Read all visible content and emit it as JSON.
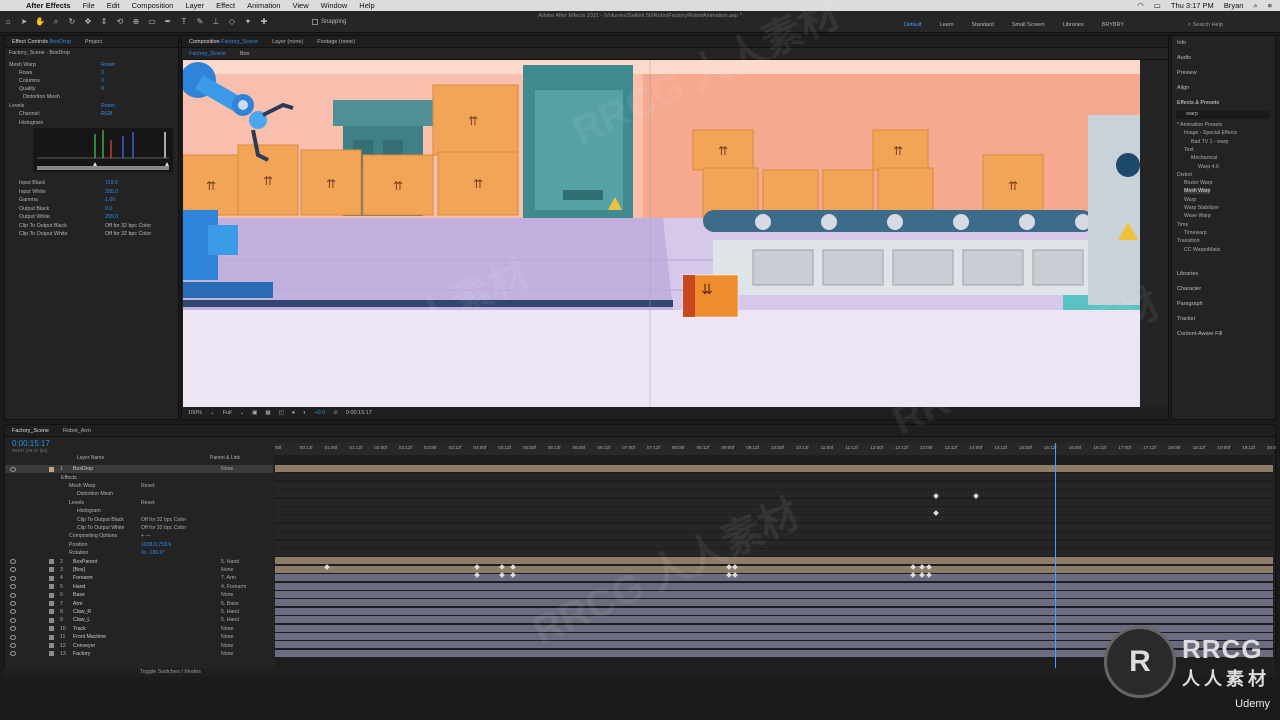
{
  "menubar": {
    "app": "After Effects",
    "items": [
      "File",
      "Edit",
      "Composition",
      "Layer",
      "Effect",
      "Animation",
      "View",
      "Window",
      "Help"
    ],
    "clock": "Thu 3:17 PM",
    "user": "Bryan"
  },
  "toolbar": {
    "snapping": "Snapping",
    "document_title": "Adobe After Effects 2021 - /Volumes/Selkirk 50/RobotFactory/RobotAnimation.aep *",
    "workspaces": [
      "Default",
      "Learn",
      "Standard",
      "Small Screen",
      "Libraries",
      "BRYBRY"
    ],
    "active_workspace": "Default",
    "search_help": "Search Help"
  },
  "effects_panel": {
    "tab": "Effect Controls",
    "tab_layer": "BoxDrop",
    "project_tab": "Project",
    "subtitle": "Factory_Scene · BoxDrop",
    "rows": [
      {
        "label": "Mesh Warp",
        "value": "Reset"
      },
      {
        "label": "Rows",
        "value": "3"
      },
      {
        "label": "Columns",
        "value": "3"
      },
      {
        "label": "Quality",
        "value": "8"
      },
      {
        "label": "Distortion Mesh",
        "value": ""
      },
      {
        "label": "Levels",
        "value": "Reset"
      },
      {
        "label": "Channel:",
        "value": "RGB"
      },
      {
        "label": "Histogram",
        "value": ""
      }
    ],
    "rows2": [
      {
        "label": "Input Black",
        "value": "119.0"
      },
      {
        "label": "Input White",
        "value": "255.0"
      },
      {
        "label": "Gamma",
        "value": "1.00"
      },
      {
        "label": "Output Black",
        "value": "0.0"
      },
      {
        "label": "Output White",
        "value": "255.0"
      },
      {
        "label": "Clip To Output Black",
        "value": "Off for 32 bpc Color"
      },
      {
        "label": "Clip To Output White",
        "value": "Off for 32 bpc Color"
      }
    ]
  },
  "comp_panel": {
    "tab": "Composition",
    "comp_name": "Factory_Scene",
    "layer_tab": "Layer (none)",
    "footage_tab": "Footage (none)",
    "breadcrumbs": [
      "Factory_Scene",
      "Box"
    ],
    "zoom": "100%",
    "resolution": "Full",
    "exposure": "+0.0",
    "timecode": "0:00:15:17"
  },
  "right_panel": {
    "panels": [
      "Info",
      "Audio",
      "Preview",
      "Align"
    ],
    "effects_title": "Effects & Presets",
    "search": "warp",
    "tree": [
      {
        "label": "* Animation Presets",
        "indent": 0
      },
      {
        "label": "Image - Special Effects",
        "indent": 1
      },
      {
        "label": "Bad TV 1 - warp",
        "indent": 2
      },
      {
        "label": "Text",
        "indent": 1
      },
      {
        "label": "Mechanical",
        "indent": 2
      },
      {
        "label": "Warp 4.6",
        "indent": 3
      },
      {
        "label": "Distort",
        "indent": 0
      },
      {
        "label": "Bezier Warp",
        "indent": 1
      },
      {
        "label": "Mesh Warp",
        "indent": 1
      },
      {
        "label": "Warp",
        "indent": 1
      },
      {
        "label": "Warp Stabilizer",
        "indent": 1
      },
      {
        "label": "Wave Warp",
        "indent": 1
      },
      {
        "label": "Time",
        "indent": 0
      },
      {
        "label": "Timewarp",
        "indent": 1
      },
      {
        "label": "Transition",
        "indent": 0
      },
      {
        "label": "CC WarpoMatic",
        "indent": 1
      }
    ],
    "panels2": [
      "Libraries",
      "Character",
      "Paragraph",
      "Tracker",
      "Content-Aware Fill"
    ]
  },
  "timeline": {
    "tabs": [
      "Factory_Scene",
      "Robot_Arm"
    ],
    "timecode": "0:00:15:17",
    "fps": "00437 (29.97 fps)",
    "col_layer_name": "Layer Name",
    "col_parent": "Parent & Link",
    "ruler": [
      "00f",
      "00:12f",
      "01:00f",
      "01:12f",
      "02:00f",
      "02:12f",
      "03:00f",
      "03:12f",
      "04:00f",
      "04:12f",
      "05:00f",
      "05:12f",
      "06:00f",
      "06:12f",
      "07:00f",
      "07:12f",
      "08:00f",
      "08:12f",
      "09:00f",
      "09:12f",
      "10:00f",
      "10:12f",
      "11:00f",
      "11:12f",
      "12:00f",
      "12:12f",
      "13:00f",
      "13:12f",
      "14:00f",
      "14:12f",
      "15:00f",
      "15:12f",
      "16:00f",
      "16:12f",
      "17:00f",
      "17:12f",
      "18:00f",
      "18:12f",
      "19:00f",
      "19:12f",
      "20:0"
    ],
    "property_rows": [
      {
        "label": "Effects",
        "indent": 1,
        "value": ""
      },
      {
        "label": "Mesh Warp",
        "indent": 2,
        "value": "Reset"
      },
      {
        "label": "Distortion Mesh",
        "indent": 3,
        "value": ""
      },
      {
        "label": "Levels",
        "indent": 2,
        "value": "Reset"
      },
      {
        "label": "Histogram",
        "indent": 3,
        "value": ""
      },
      {
        "label": "Clip To Output Black",
        "indent": 3,
        "value": "Off for 32 bpc Color"
      },
      {
        "label": "Clip To Output White",
        "indent": 3,
        "value": "Off for 32 bpc Color"
      },
      {
        "label": "Compositing Options",
        "indent": 2,
        "value": "+ —"
      },
      {
        "label": "Position",
        "indent": 2,
        "value": "1038.0,758.6"
      },
      {
        "label": "Rotation",
        "indent": 2,
        "value": "0x -180.0°"
      }
    ],
    "layers": [
      {
        "num": "1",
        "name": "BoxDrop",
        "parent": "None"
      },
      {
        "num": "2",
        "name": "BoxParent",
        "parent": "5. Hand"
      },
      {
        "num": "3",
        "name": "[Box]",
        "parent": "None"
      },
      {
        "num": "4",
        "name": "Forearm",
        "parent": "7. Arm"
      },
      {
        "num": "5",
        "name": "Hand",
        "parent": "4. Forearm"
      },
      {
        "num": "6",
        "name": "Base",
        "parent": "None"
      },
      {
        "num": "7",
        "name": "Arm",
        "parent": "6. Base"
      },
      {
        "num": "8",
        "name": "Claw_R",
        "parent": "5. Hand"
      },
      {
        "num": "9",
        "name": "Claw_L",
        "parent": "5. Hand"
      },
      {
        "num": "10",
        "name": "Track",
        "parent": "None"
      },
      {
        "num": "11",
        "name": "Front Machine",
        "parent": "None"
      },
      {
        "num": "12",
        "name": "Conveyor",
        "parent": "None"
      },
      {
        "num": "13",
        "name": "Factory",
        "parent": "None"
      }
    ],
    "toggle": "Toggle Switches / Modes"
  },
  "watermark": {
    "logo_text": "RRCG",
    "subtitle": "人人素材",
    "udemy": "Udemy",
    "overlay": "RRCG 人人素材"
  },
  "colors": {
    "accent": "#2d8ceb",
    "playhead": "#4a9cff",
    "box": "#f2a557",
    "wall": "#f7c7b5",
    "floor": "#c6b4e0"
  }
}
